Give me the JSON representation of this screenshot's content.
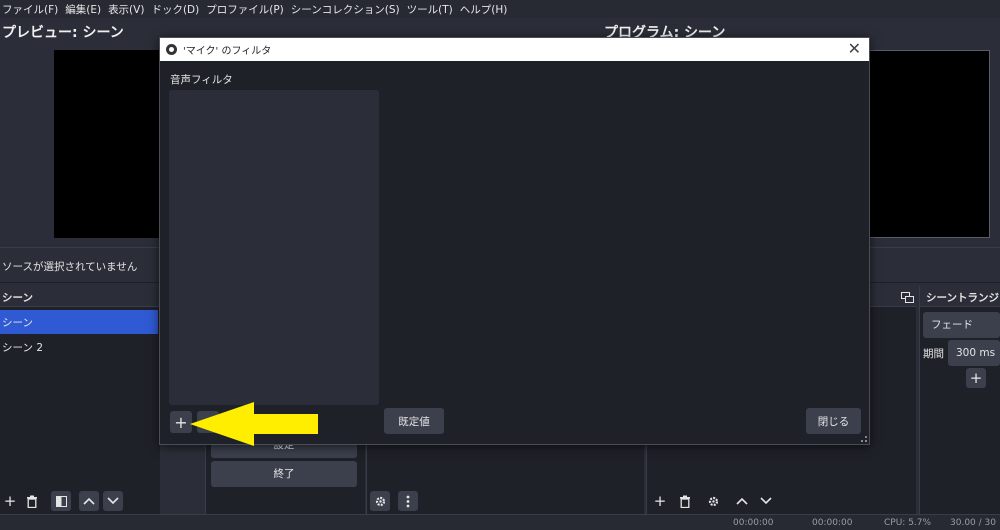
{
  "menu": [
    "ファイル(F)",
    "編集(E)",
    "表示(V)",
    "ドック(D)",
    "プロファイル(P)",
    "シーンコレクション(S)",
    "ツール(T)",
    "ヘルプ(H)"
  ],
  "preview": {
    "title": "プレビュー: シーン"
  },
  "program": {
    "title": "プログラム: シーン"
  },
  "source_bar": {
    "text": "ソースが選択されていません"
  },
  "scenes": {
    "header": "シーン",
    "items": [
      "シーン",
      "シーン 2"
    ]
  },
  "controls": {
    "settings_label": "設定",
    "exit_label": "終了"
  },
  "transitions": {
    "header": "シーントランジション",
    "type": "フェード",
    "duration_label": "期間",
    "duration_value": "300 ms"
  },
  "dialog": {
    "title": "'マイク' のフィルタ",
    "audio_filters_label": "音声フィルタ",
    "defaults_button": "既定値",
    "close_button": "閉じる"
  },
  "status": {
    "time1": "00:00:00",
    "time2": "00:00:00",
    "cpu": "CPU: 5.7%",
    "fps": "30.00 / 30"
  },
  "colors": {
    "accent": "#2f5ad3",
    "arrow": "#ffee00"
  }
}
